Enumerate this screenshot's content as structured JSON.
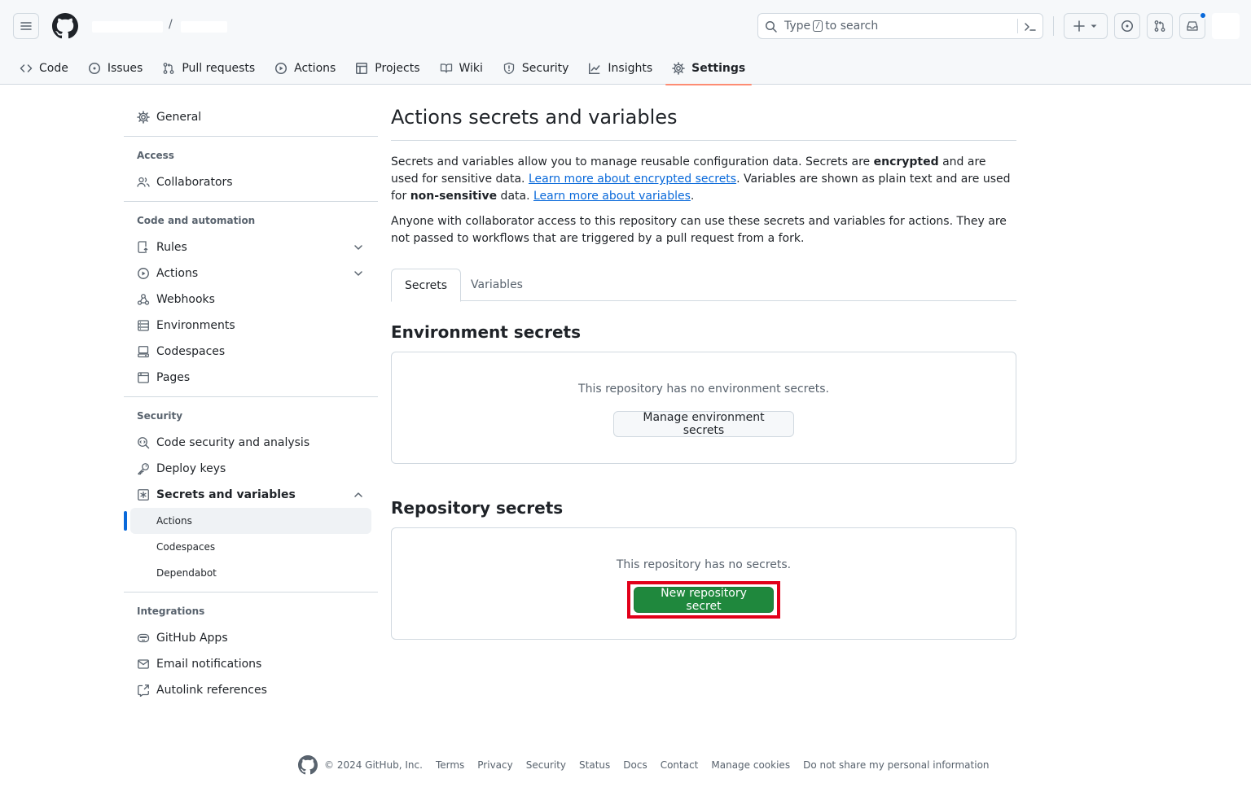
{
  "header": {
    "breadcrumb_separator": "/",
    "search": {
      "text_before": "Type",
      "kbd": "/",
      "text_after": "to search"
    }
  },
  "repo_nav": {
    "tabs": [
      {
        "label": "Code",
        "icon": "code-icon"
      },
      {
        "label": "Issues",
        "icon": "issue-icon"
      },
      {
        "label": "Pull requests",
        "icon": "pull-request-icon"
      },
      {
        "label": "Actions",
        "icon": "play-icon"
      },
      {
        "label": "Projects",
        "icon": "table-icon"
      },
      {
        "label": "Wiki",
        "icon": "book-icon"
      },
      {
        "label": "Security",
        "icon": "shield-icon"
      },
      {
        "label": "Insights",
        "icon": "graph-icon"
      },
      {
        "label": "Settings",
        "icon": "gear-icon",
        "selected": true
      }
    ]
  },
  "sidebar": {
    "general": "General",
    "access_heading": "Access",
    "collaborators": "Collaborators",
    "code_heading": "Code and automation",
    "rules": "Rules",
    "actions": "Actions",
    "webhooks": "Webhooks",
    "environments": "Environments",
    "codespaces": "Codespaces",
    "pages": "Pages",
    "security_heading": "Security",
    "code_security": "Code security and analysis",
    "deploy_keys": "Deploy keys",
    "secrets_variables": "Secrets and variables",
    "sub_actions": "Actions",
    "sub_codespaces": "Codespaces",
    "sub_dependabot": "Dependabot",
    "integrations_heading": "Integrations",
    "github_apps": "GitHub Apps",
    "email_notifications": "Email notifications",
    "autolink_references": "Autolink references"
  },
  "main": {
    "title": "Actions secrets and variables",
    "intro": {
      "p1_a": "Secrets and variables allow you to manage reusable configuration data. Secrets are ",
      "p1_b": "encrypted",
      "p1_c": " and are used for sensitive data. ",
      "p1_link1": "Learn more about encrypted secrets",
      "p1_d": ". Variables are shown as plain text and are used for ",
      "p1_e": "non-sensitive",
      "p1_f": " data. ",
      "p1_link2": "Learn more about variables",
      "p1_g": ".",
      "p2": "Anyone with collaborator access to this repository can use these secrets and variables for actions. They are not passed to workflows that are triggered by a pull request from a fork."
    },
    "tabs": {
      "secrets": "Secrets",
      "variables": "Variables"
    },
    "env_secrets": {
      "title": "Environment secrets",
      "message": "This repository has no environment secrets.",
      "button": "Manage environment secrets"
    },
    "repo_secrets": {
      "title": "Repository secrets",
      "message": "This repository has no secrets.",
      "button": "New repository secret"
    }
  },
  "footer": {
    "copyright": "© 2024 GitHub, Inc.",
    "links": [
      "Terms",
      "Privacy",
      "Security",
      "Status",
      "Docs",
      "Contact",
      "Manage cookies",
      "Do not share my personal information"
    ]
  },
  "colors": {
    "accent": "#0969da",
    "primary_button": "#1f883d",
    "selected_tab_underline": "#fd8c73",
    "highlight_box": "#e2001a"
  }
}
